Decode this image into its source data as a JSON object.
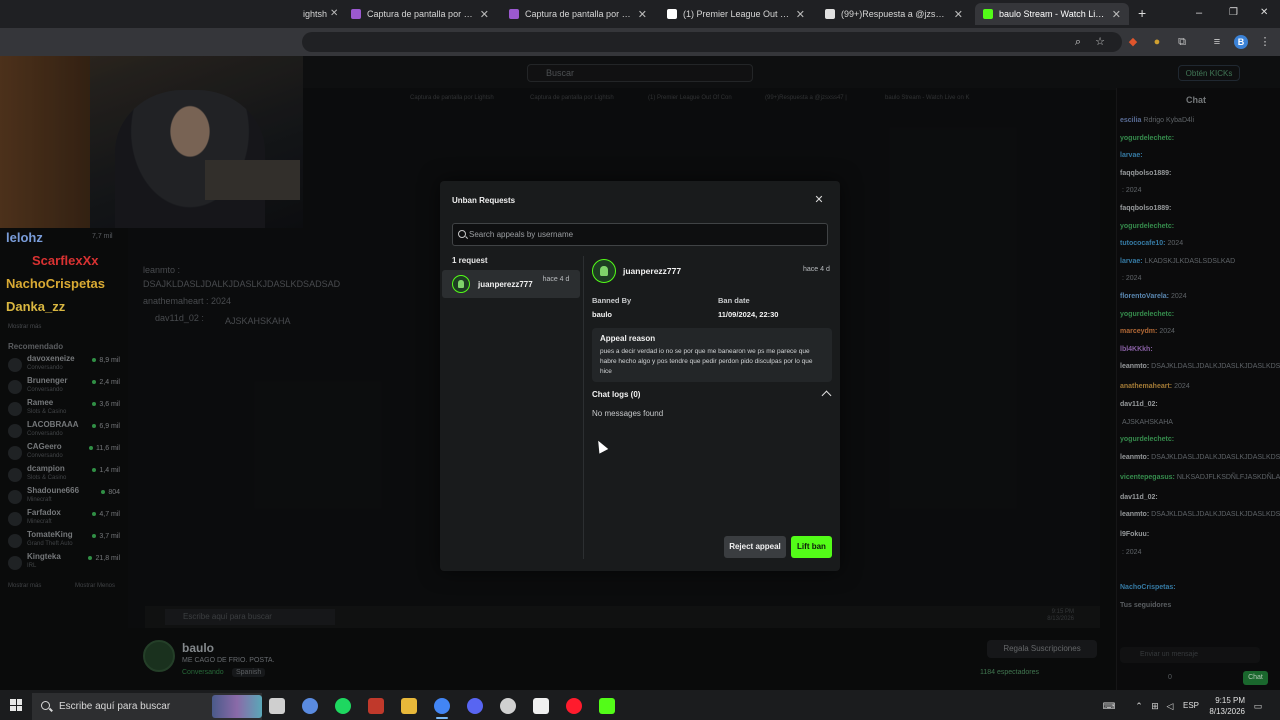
{
  "browser": {
    "tabs": [
      {
        "label": "Captura de pantalla por Lightsh",
        "icon": "lightshot-icon"
      },
      {
        "label": "Captura de pantalla por Lightsh",
        "icon": "lightshot-icon"
      },
      {
        "label": "(1) Premier League Out Of Con",
        "icon": "x-icon"
      },
      {
        "label": "(99+)Respuesta a @jzsxss47 |",
        "icon": "tiktok-icon"
      },
      {
        "label": "baulo Stream - Watch Live on K",
        "icon": "kick-icon"
      }
    ],
    "partial_tab_label": "ightsh",
    "new_tab": "+",
    "window_controls": [
      "–",
      "❐",
      "✕"
    ]
  },
  "kick_page": {
    "search_placeholder": "Buscar",
    "obtain_label": "Obtén KICKs",
    "chat_title": "Chat",
    "chat_input_placeholder": "Enviar un mensaje",
    "chat_send": "Chat",
    "chat_points": "0"
  },
  "overlay_chat": [
    {
      "name": "lelohz",
      "color": "#8fb8ff",
      "count": "7,7 mil"
    },
    {
      "name": "ScarflexXx",
      "color": "#ff3b3b",
      "count": ""
    },
    {
      "name": "NachoCrispetas",
      "color": "#ffc83d",
      "count": ""
    },
    {
      "name": "Danka_zz",
      "color": "#ffd84d",
      "count": ""
    }
  ],
  "overlay_texts": {
    "line1": "leanmto :",
    "line2": "DSAJKLDASLJDALKJDASLKJDASLKDSADSAD",
    "line3": "anathemaheart : 2024",
    "line4": "dav11d_02 :",
    "line5": "AJSKAHSKAHA",
    "show_more": "Mostrar más"
  },
  "recommended": {
    "title": "Recomendado",
    "items": [
      {
        "name": "davoxeneize",
        "sub": "Conversando",
        "count": "8,9 mil"
      },
      {
        "name": "Brunenger",
        "sub": "Conversando",
        "count": "2,4 mil"
      },
      {
        "name": "Ramee",
        "sub": "Slots & Casino",
        "count": "3,6 mil"
      },
      {
        "name": "LACOBRAAA",
        "sub": "Conversando",
        "count": "6,9 mil"
      },
      {
        "name": "CAGeero",
        "sub": "Conversando",
        "count": "11,6 mil"
      },
      {
        "name": "dcampion",
        "sub": "Slots & Casino",
        "count": "1,4 mil"
      },
      {
        "name": "Shadoune666",
        "sub": "Minecraft",
        "count": "804"
      },
      {
        "name": "Farfadox",
        "sub": "Minecraft",
        "count": "4,7 mil"
      },
      {
        "name": "TomateKing",
        "sub": "Grand Theft Auto",
        "count": "3,7 mil"
      },
      {
        "name": "Kingteka",
        "sub": "IRL",
        "count": "21,8 mil"
      }
    ],
    "show_more": "Mostrar más",
    "show_less": "Mostrar Menos"
  },
  "stream_info": {
    "streamer": "baulo",
    "title": "ME CAGO DE FRIO. POSTA.",
    "category": "Conversando",
    "tag": "Spanish",
    "subs_button": "Regala Suscripciones",
    "viewers": "1184 espectadores"
  },
  "inner": {
    "search_placeholder": "Escribe aquí para buscar",
    "time": "9:15 PM",
    "date": "8/13/2026"
  },
  "chat_messages": [
    {
      "user": "escilia",
      "text": "Rdrigo  KybaD4li",
      "color": "#6a7fb0"
    },
    {
      "user": "yogurdelechetc:",
      "text": "",
      "color": "#3fa45a"
    },
    {
      "user": "larvae:",
      "text": "",
      "color": "#3f8fc0"
    },
    {
      "user": "faqqbolso1889:",
      "text": "",
      "color": "#b0b3b6"
    },
    {
      "user": "",
      "text": ": 2024",
      "color": "#b0b3b6"
    },
    {
      "user": "faqqbolso1889:",
      "text": "",
      "color": "#b0b3b6"
    },
    {
      "user": "yogurdelechetc:",
      "text": "",
      "color": "#3fa45a"
    },
    {
      "user": "tutococafe10:",
      "text": "2024",
      "color": "#3f8fc0"
    },
    {
      "user": "larvae:",
      "text": "LKADSKJLKDASLSDSLKAD",
      "color": "#3f8fc0"
    },
    {
      "user": "",
      "text": ": 2024",
      "color": "#b04040"
    },
    {
      "user": "florentoVarela:",
      "text": "2024",
      "color": "#6a9fd0"
    },
    {
      "user": "yogurdelechetc:",
      "text": "",
      "color": "#3fa45a"
    },
    {
      "user": "marceydm:",
      "text": "2024",
      "color": "#d07a3f"
    },
    {
      "user": "lbl4KKkh:",
      "text": "",
      "color": "#a070c0"
    },
    {
      "user": "leanmto:",
      "text": "DSAJKLDASLJDALKJDASLKJDASLKDSADSAD",
      "color": "#b0b3b6"
    },
    {
      "user": "anathemaheart:",
      "text": "2024",
      "color": "#c09040"
    },
    {
      "user": "dav11d_02:",
      "text": "",
      "color": "#b0b3b6"
    },
    {
      "user": "",
      "text": "AJSKAHSKAHA",
      "color": "#b04060"
    },
    {
      "user": "yogurdelechetc:",
      "text": "",
      "color": "#3fa45a"
    },
    {
      "user": "leanmto:",
      "text": "DSAJKLDASLJDALKJDASLKJDASLKDSADSAD",
      "color": "#b0b3b6"
    },
    {
      "user": "vicentepegasus:",
      "text": "NLKSADJFLKSDÑLFJASKDÑLA",
      "color": "#3fa45a"
    },
    {
      "user": "dav11d_02:",
      "text": "",
      "color": "#b0b3b6"
    },
    {
      "user": "leanmto:",
      "text": "DSAJKLDASLJDALKJDASLKJDASLKDSADSAD",
      "color": "#b0b3b6"
    },
    {
      "user": "l9Fokuu:",
      "text": "",
      "color": "#b0b3b6"
    },
    {
      "user": "",
      "text": ": 2024",
      "color": "#c05030"
    },
    {
      "user": "",
      "text": "",
      "color": "#b0b3b6"
    },
    {
      "user": "NachoCrispetas:",
      "text": "",
      "color": "#3f8fc0"
    },
    {
      "user": "Tus seguidores",
      "text": "",
      "color": "#6a6e72"
    }
  ],
  "modal": {
    "title": "Unban Requests",
    "search_placeholder": "Search appeals by username",
    "request_count": "1 request",
    "requests": [
      {
        "username": "juanperezz777",
        "time": "hace 4 d"
      }
    ],
    "detail": {
      "username": "juanperezz777",
      "time": "hace 4 d",
      "banned_by_label": "Banned By",
      "banned_by": "baulo",
      "ban_date_label": "Ban date",
      "ban_date": "11/09/2024, 22:30",
      "appeal_reason_label": "Appeal reason",
      "appeal_reason": "pues a decir verdad io no se por que me banearon we ps me parece que habre hecho algo y pos tendre que pedir perdon pido disculpas por lo que hice",
      "chat_logs_label": "Chat logs (0)",
      "no_messages": "No messages found"
    },
    "reject_label": "Reject appeal",
    "lift_label": "Lift ban"
  },
  "taskbar": {
    "search_placeholder": "Escribe aquí para buscar",
    "lang": "ESP",
    "time": "9:15 PM",
    "date": "8/13/2026",
    "apps": [
      "task-view-icon",
      "copilot-icon",
      "spotify-icon",
      "voicemod-icon",
      "file-explorer-icon",
      "chrome-icon",
      "discord-icon",
      "obs-icon",
      "capcut-icon",
      "opera-icon",
      "kick-icon"
    ]
  },
  "colors": {
    "kick_green": "#53fc18",
    "modal_bg": "#191b1c",
    "reject_bg": "#3a3d40"
  }
}
